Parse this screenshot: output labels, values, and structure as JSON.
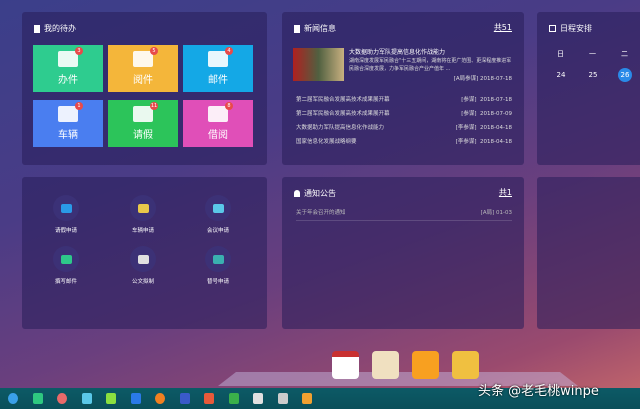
{
  "todo": {
    "title": "我的待办",
    "tiles": [
      {
        "label": "办件",
        "badge": "3",
        "color": "#2ecc8f"
      },
      {
        "label": "阅件",
        "badge": "5",
        "color": "#f4b63a"
      },
      {
        "label": "邮件",
        "badge": "4",
        "color": "#14a8e6"
      },
      {
        "label": "车辆",
        "badge": "1",
        "color": "#4a7ef0"
      },
      {
        "label": "请假",
        "badge": "11",
        "color": "#2cc45a"
      },
      {
        "label": "借阅",
        "badge": "8",
        "color": "#e04fb8"
      }
    ]
  },
  "news": {
    "title": "新闻信息",
    "count": "共51",
    "featured": {
      "title": "大数据助力军队提高信息化作战能力",
      "summary": "湖南深度发展军民融合\"十三五期间，湖南将在更广范围、更深程度推进军民融合深度发展，力争军民融合产业产值年 ...",
      "author": "[A局参谋]",
      "date": "2018-07-18"
    },
    "items": [
      {
        "title": "第二届军民融合发展高技术成果展开幕",
        "author": "[参谋]",
        "date": "2018-07-18"
      },
      {
        "title": "第二届军民融合发展高技术成果展开幕",
        "author": "[参谋]",
        "date": "2018-07-09"
      },
      {
        "title": "大数据助力军队提高信息化作战能力",
        "author": "[李参谋]",
        "date": "2018-04-18"
      },
      {
        "title": "国家信息化发展战略纲要",
        "author": "[李参谋]",
        "date": "2018-04-18"
      }
    ]
  },
  "schedule": {
    "title": "日程安排",
    "weekdays": [
      "日",
      "一",
      "二"
    ],
    "days": [
      "24",
      "25",
      "26"
    ],
    "today": "26"
  },
  "quick": {
    "items": [
      {
        "label": "请假申请",
        "color": "#2a9ae8"
      },
      {
        "label": "车辆申请",
        "color": "#e8c84a"
      },
      {
        "label": "会议申请",
        "color": "#5ac8e8"
      },
      {
        "label": "撰写邮件",
        "color": "#2ec88a"
      },
      {
        "label": "公文拟制",
        "color": "#e0e0e0"
      },
      {
        "label": "替号申请",
        "color": "#3ab0b0"
      }
    ]
  },
  "notice": {
    "title": "通知公告",
    "count": "共1",
    "items": [
      {
        "title": "关于年会召开的通知",
        "author": "[A局]",
        "date": "01-03"
      }
    ]
  },
  "watermark": "头条 @老毛桃winpe",
  "taskbar": {
    "icons": [
      "start",
      "app-green",
      "app-red",
      "app-folder",
      "app-doc",
      "app-blue",
      "firefox",
      "word",
      "ppt",
      "excel",
      "app-mail",
      "gear-icon",
      "app-notes"
    ]
  },
  "dock": {
    "icons": [
      "calendar",
      "contacts",
      "messages",
      "notes"
    ]
  }
}
